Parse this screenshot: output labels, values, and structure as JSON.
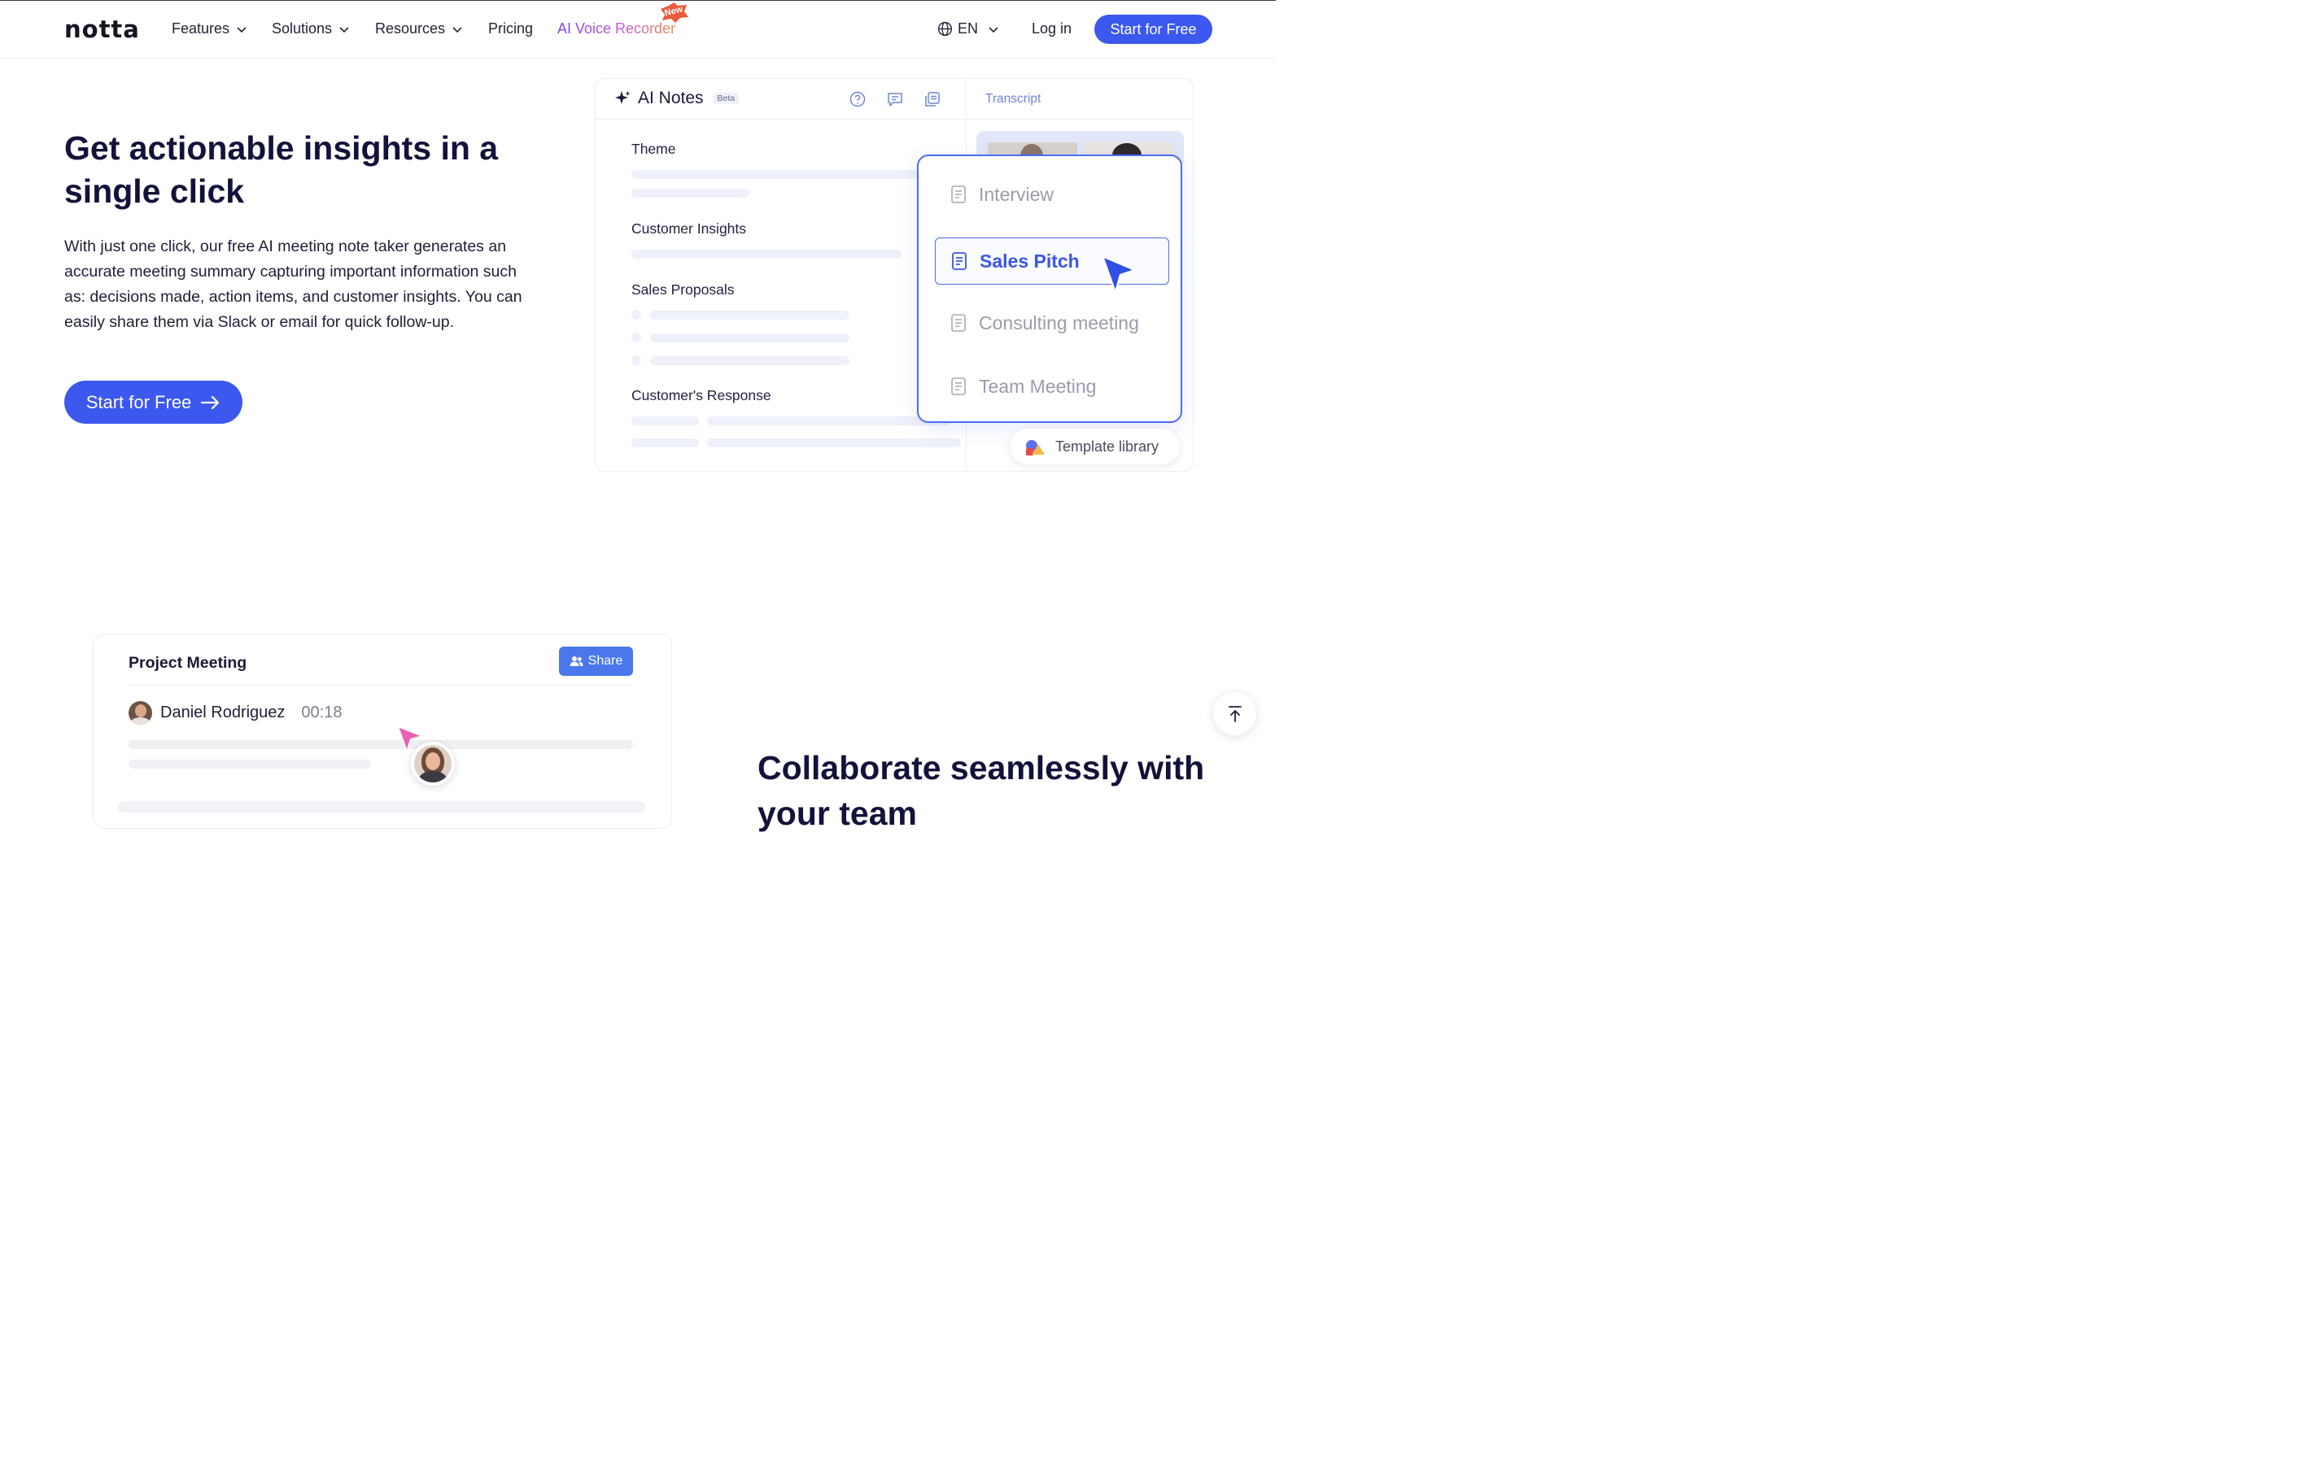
{
  "nav": {
    "logo": "notta",
    "items": [
      {
        "label": "Features"
      },
      {
        "label": "Solutions"
      },
      {
        "label": "Resources"
      },
      {
        "label": "Pricing"
      },
      {
        "label": "AI Voice Recorder"
      }
    ],
    "new_badge": "New",
    "language": "EN",
    "login": "Log in",
    "cta": "Start for Free"
  },
  "hero": {
    "title": "Get actionable insights in a single click",
    "description": "With just one click, our free AI meeting note taker generates an accurate meeting summary capturing important information such as: decisions made, action items, and customer insights. You can easily share them via Slack or email for quick follow-up.",
    "cta": "Start for Free"
  },
  "notes_card": {
    "title": "AI Notes",
    "beta": "Beta",
    "transcript_tab": "Transcript",
    "sections": [
      "Theme",
      "Customer Insights",
      "Sales Proposals",
      "Customer's Response"
    ],
    "templates": [
      {
        "label": "Interview",
        "active": false
      },
      {
        "label": "Sales Pitch",
        "active": true
      },
      {
        "label": "Consulting meeting",
        "active": false
      },
      {
        "label": "Team Meeting",
        "active": false
      }
    ],
    "template_library": "Template library"
  },
  "meeting_card": {
    "title": "Project Meeting",
    "share": "Share",
    "speaker": "Daniel Rodriguez",
    "timestamp": "00:18"
  },
  "collab": {
    "title": "Collaborate seamlessly with your team"
  },
  "colors": {
    "primary": "#3c58ee",
    "accent_border": "#4c6cf0",
    "share": "#4a78ec",
    "heading": "#12123a"
  }
}
